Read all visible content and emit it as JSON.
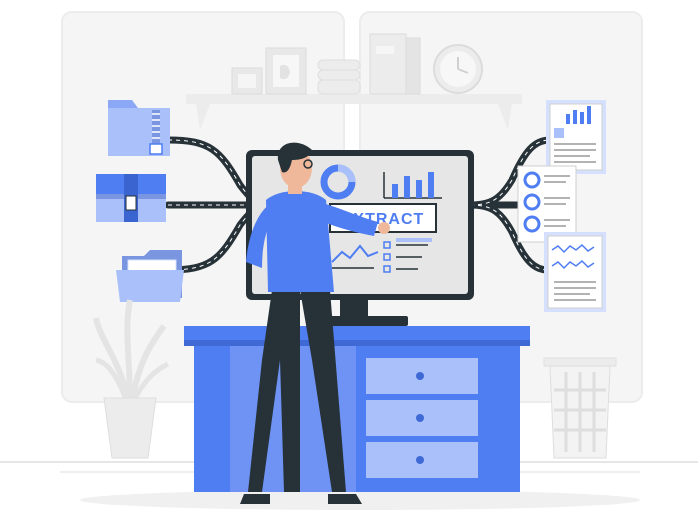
{
  "screen": {
    "button_label": "EXTRACT"
  },
  "colors": {
    "accent": "#4f7df2",
    "accent_light": "#a9c0fa",
    "accent_pale": "#d4e0fd",
    "dark": "#263238",
    "bg_gray": "#f2f2f2",
    "line_gray": "#e3e3e3"
  },
  "icons": {
    "zip_folder": "zip-folder-icon",
    "archive_box": "archive-box-icon",
    "open_folder": "open-folder-icon",
    "bar_chart_doc": "bar-chart-document-icon",
    "list_doc": "list-document-icon",
    "wave_doc": "wave-chart-document-icon",
    "clock": "clock-icon",
    "plant": "plant-icon",
    "trash": "wastebasket-icon"
  }
}
